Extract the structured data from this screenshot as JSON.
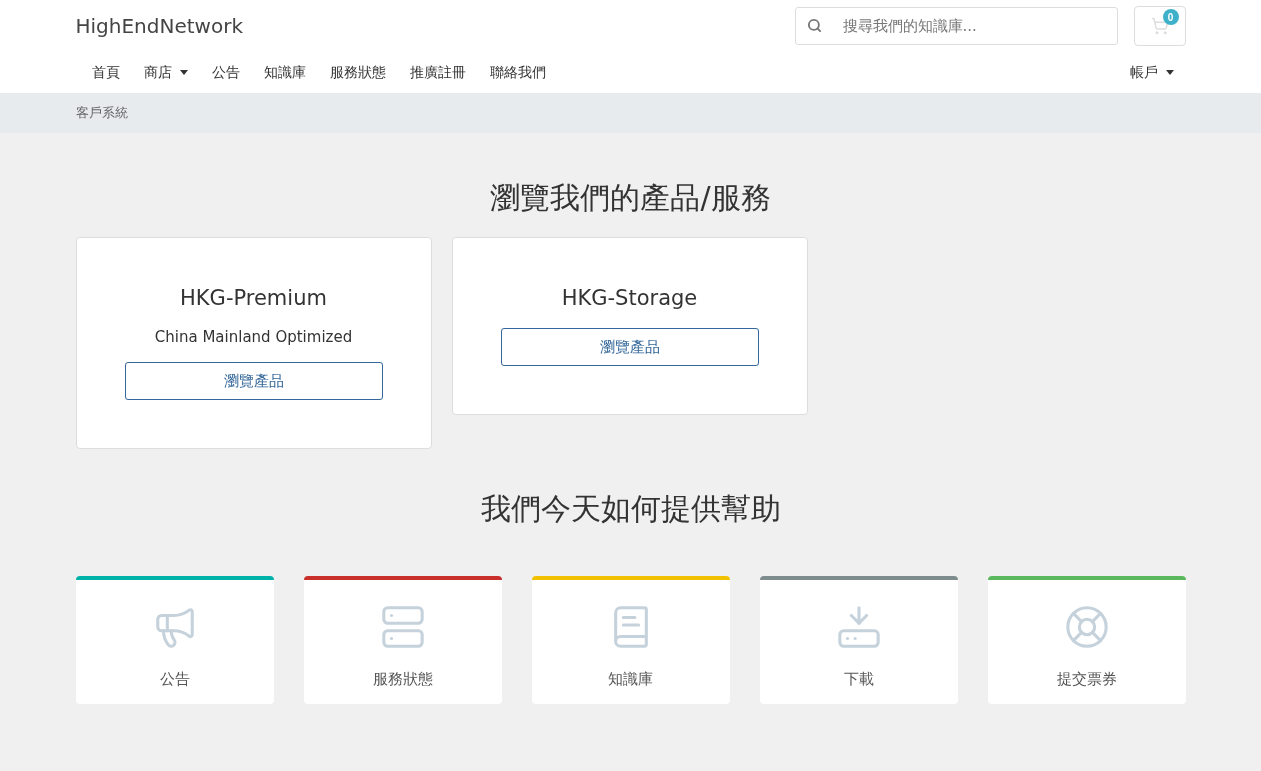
{
  "brand": "HighEndNetwork",
  "search": {
    "placeholder": "搜尋我們的知識庫..."
  },
  "cart": {
    "count": "0"
  },
  "nav": [
    {
      "label": "首頁",
      "dropdown": false
    },
    {
      "label": "商店",
      "dropdown": true
    },
    {
      "label": "公告",
      "dropdown": false
    },
    {
      "label": "知識庫",
      "dropdown": false
    },
    {
      "label": "服務狀態",
      "dropdown": false
    },
    {
      "label": "推廣註冊",
      "dropdown": false
    },
    {
      "label": "聯絡我們",
      "dropdown": false
    }
  ],
  "account": {
    "label": "帳戶",
    "dropdown": true
  },
  "breadcrumb": "客戶系統",
  "products_heading": "瀏覽我們的產品/服務",
  "products": [
    {
      "name": "HKG-Premium",
      "tagline": "China Mainland Optimized",
      "button": "瀏覽產品"
    },
    {
      "name": "HKG-Storage",
      "button": "瀏覽產品"
    }
  ],
  "help_heading": "我們今天如何提供幫助",
  "help": [
    {
      "kind": "announcements",
      "label": "公告",
      "color": "#00b3a8"
    },
    {
      "kind": "status",
      "label": "服務狀態",
      "color": "#c9302c"
    },
    {
      "kind": "knowledgebase",
      "label": "知識庫",
      "color": "#f2c200"
    },
    {
      "kind": "downloads",
      "label": "下載",
      "color": "#7f8c8d"
    },
    {
      "kind": "support",
      "label": "提交票券",
      "color": "#5cb85c"
    }
  ]
}
